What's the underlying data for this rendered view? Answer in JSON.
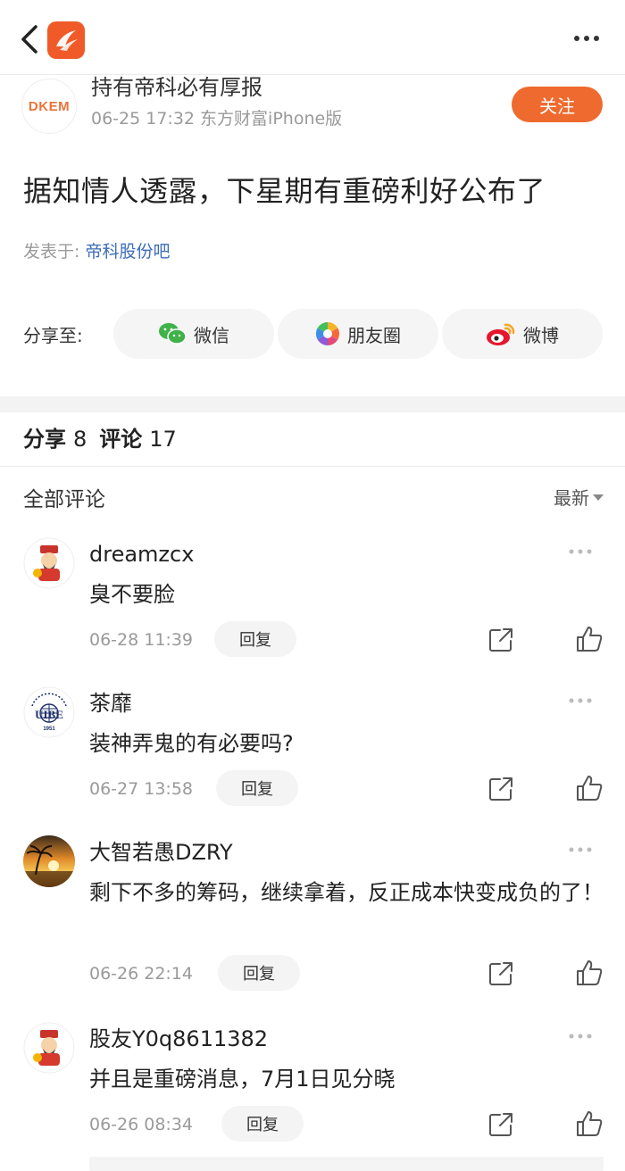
{
  "author": {
    "avatar_text": "DKEM",
    "name": "持有帝科必有厚报",
    "meta": "06-25 17:32 东方财富iPhone版",
    "follow_label": "关注"
  },
  "post": {
    "title": "据知情人透露，下星期有重磅利好公布了",
    "posted_in_label": "发表于:",
    "posted_in_link": "帝科股份吧"
  },
  "share": {
    "label": "分享至:",
    "targets": [
      "微信",
      "朋友圈",
      "微博"
    ]
  },
  "stats": {
    "share_label": "分享",
    "share_count": "8",
    "comment_label": "评论",
    "comment_count": "17"
  },
  "comments_header": {
    "title": "全部评论",
    "sort": "最新"
  },
  "comments": [
    {
      "name": "dreamzcx",
      "text": "臭不要脸",
      "time": "06-28 11:39",
      "reply": "回复",
      "avatar": "fortune-god-icon"
    },
    {
      "name": "茶靡",
      "text": "装神弄鬼的有必要吗?",
      "time": "06-27 13:58",
      "reply": "回复",
      "avatar": "uibe-logo-icon",
      "avatar_text": "UIBE",
      "avatar_year": "1951"
    },
    {
      "name": "大智若愚DZRY",
      "text": "剩下不多的筹码，继续拿着，反正成本快变成负的了！",
      "time": "06-26 22:14",
      "reply": "回复",
      "avatar": "sunset-palm-icon"
    },
    {
      "name": "股友Y0q8611382",
      "text": "并且是重磅消息，7月1日见分晓",
      "time": "06-26 08:34",
      "reply": "回复",
      "avatar": "fortune-god-icon"
    }
  ],
  "colors": {
    "accent": "#ef6a2e",
    "link": "#3d6cb8",
    "muted": "#9a9a9a"
  }
}
